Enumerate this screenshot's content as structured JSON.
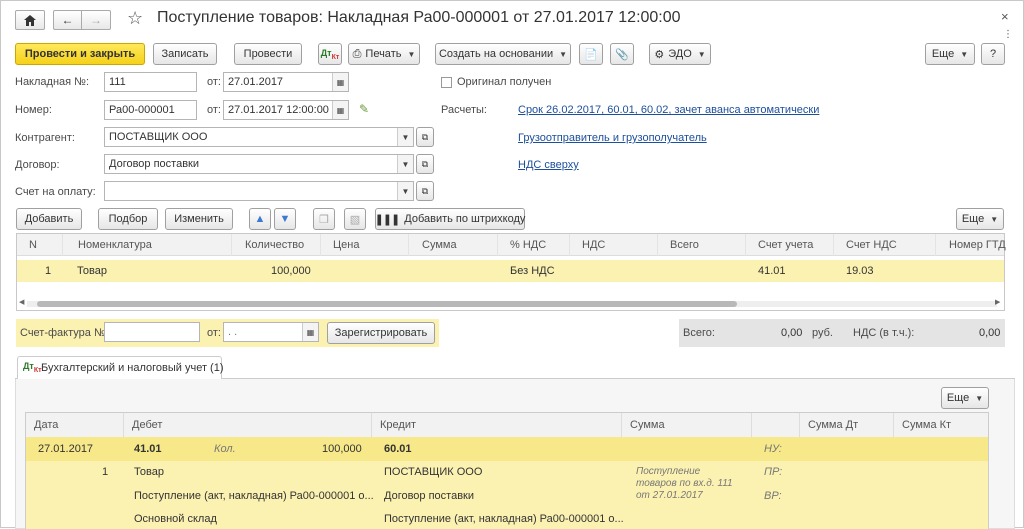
{
  "window": {
    "title": "Поступление товаров: Накладная Ра00-000001 от 27.01.2017 12:00:00"
  },
  "toolbar": {
    "post_close": "Провести и закрыть",
    "save": "Записать",
    "post": "Провести",
    "print": "Печать",
    "create_based": "Создать на основании",
    "edo": "ЭДО",
    "more": "Еще",
    "help": "?"
  },
  "form": {
    "invoice_label": "Накладная №:",
    "invoice_value": "111",
    "invoice_date_label": "от:",
    "invoice_date": "27.01.2017",
    "number_label": "Номер:",
    "number_value": "Ра00-000001",
    "number_date_label": "от:",
    "number_date": "27.01.2017 12:00:00",
    "contractor_label": "Контрагент:",
    "contractor_value": "ПОСТАВЩИК ООО",
    "contract_label": "Договор:",
    "contract_value": "Договор поставки",
    "payment_label": "Счет на оплату:",
    "payment_value": "",
    "original_received": "Оригинал получен",
    "settlements_label": "Расчеты:",
    "settlements_link": "Срок 26.02.2017, 60.01, 60.02, зачет аванса автоматически",
    "shipper_link": "Грузоотправитель и грузополучатель",
    "vat_link": "НДС сверху"
  },
  "table_toolbar": {
    "add": "Добавить",
    "pick": "Подбор",
    "change": "Изменить",
    "add_barcode": "Добавить по штрихкоду",
    "more": "Еще"
  },
  "goods_table": {
    "headers": [
      "N",
      "Номенклатура",
      "Количество",
      "Цена",
      "Сумма",
      "% НДС",
      "НДС",
      "Всего",
      "Счет учета",
      "Счет НДС",
      "Номер ГТД"
    ],
    "row": {
      "n": "1",
      "item": "Товар",
      "qty": "100,000",
      "price": "",
      "sum": "",
      "vat_rate": "Без НДС",
      "vat": "",
      "total": "",
      "account": "41.01",
      "vat_account": "19.03",
      "gtd": ""
    }
  },
  "invoice_section": {
    "label": "Счет-фактура №:",
    "number": "",
    "date_label": "от:",
    "date_placeholder": ". .",
    "register": "Зарегистрировать"
  },
  "totals": {
    "total_label": "Всего:",
    "total_value": "0,00",
    "currency": "руб.",
    "vat_label": "НДС (в т.ч.):",
    "vat_value": "0,00"
  },
  "tabs": [
    {
      "label": "Бухгалтерский и налоговый учет (1)"
    }
  ],
  "postings": {
    "more": "Еще",
    "headers": [
      "Дата",
      "Дебет",
      "Кредит",
      "Сумма",
      "",
      "Сумма Дт",
      "Сумма Кт"
    ],
    "row": {
      "date": "27.01.2017",
      "n": "1",
      "debit_account": "41.01",
      "debit_qty_label": "Кол.",
      "debit_qty": "100,000",
      "debit_sub1": "Товар",
      "debit_sub2": "Поступление (акт, накладная) Ра00-000001 о...",
      "debit_sub3": "Основной склад",
      "credit_account": "60.01",
      "credit_sub1": "ПОСТАВЩИК ООО",
      "credit_sub2": "Договор поставки",
      "credit_sub3": "Поступление (акт, накладная) Ра00-000001 о...",
      "content": "Поступление товаров по вх.д. 111 от 27.01.2017",
      "nu": "НУ:",
      "pr": "ПР:",
      "vr": "ВР:"
    }
  }
}
